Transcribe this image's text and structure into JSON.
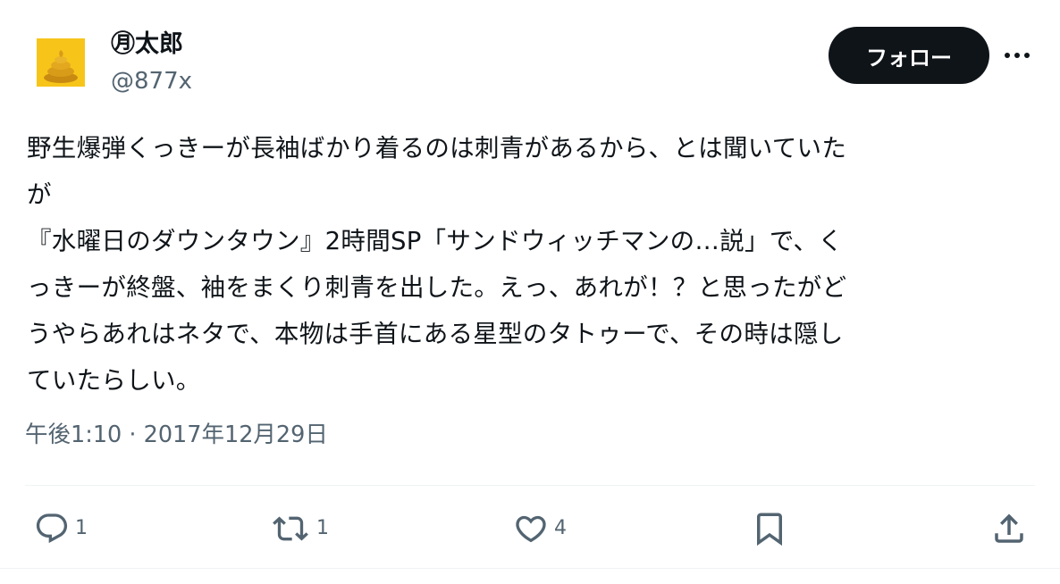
{
  "author": {
    "display_name": "㊊太郎",
    "handle": "@877x",
    "avatar_icon": "avatar-image",
    "avatar_bg": "#f7c51a"
  },
  "header": {
    "follow_label": "フォロー",
    "more_icon": "more-dots-icon"
  },
  "tweet": {
    "lines": [
      "野生爆弾くっきーが長袖ばかり着るのは刺青があるから、とは聞いていた",
      "が",
      "『水曜日のダウンタウン』2時間SP「サンドウィッチマンの…説」で、く",
      "っきーが終盤、袖をまくり刺青を出した。えっ、あれが！？と思ったがど",
      "うやらあれはネタで、本物は手首にある星型のタトゥーで、その時は隠し",
      "ていたらしい。"
    ],
    "time": "午後1:10",
    "separator": "·",
    "date": "2017年12月29日"
  },
  "actions": {
    "reply": {
      "icon": "reply-icon",
      "count": "1"
    },
    "retweet": {
      "icon": "retweet-icon",
      "count": "1"
    },
    "like": {
      "icon": "heart-icon",
      "count": "4"
    },
    "bookmark": {
      "icon": "bookmark-icon"
    },
    "share": {
      "icon": "share-icon"
    }
  },
  "colors": {
    "text": "#0f1419",
    "secondary": "#536471",
    "button_bg": "#0f1419",
    "divider": "#eff3f4"
  }
}
